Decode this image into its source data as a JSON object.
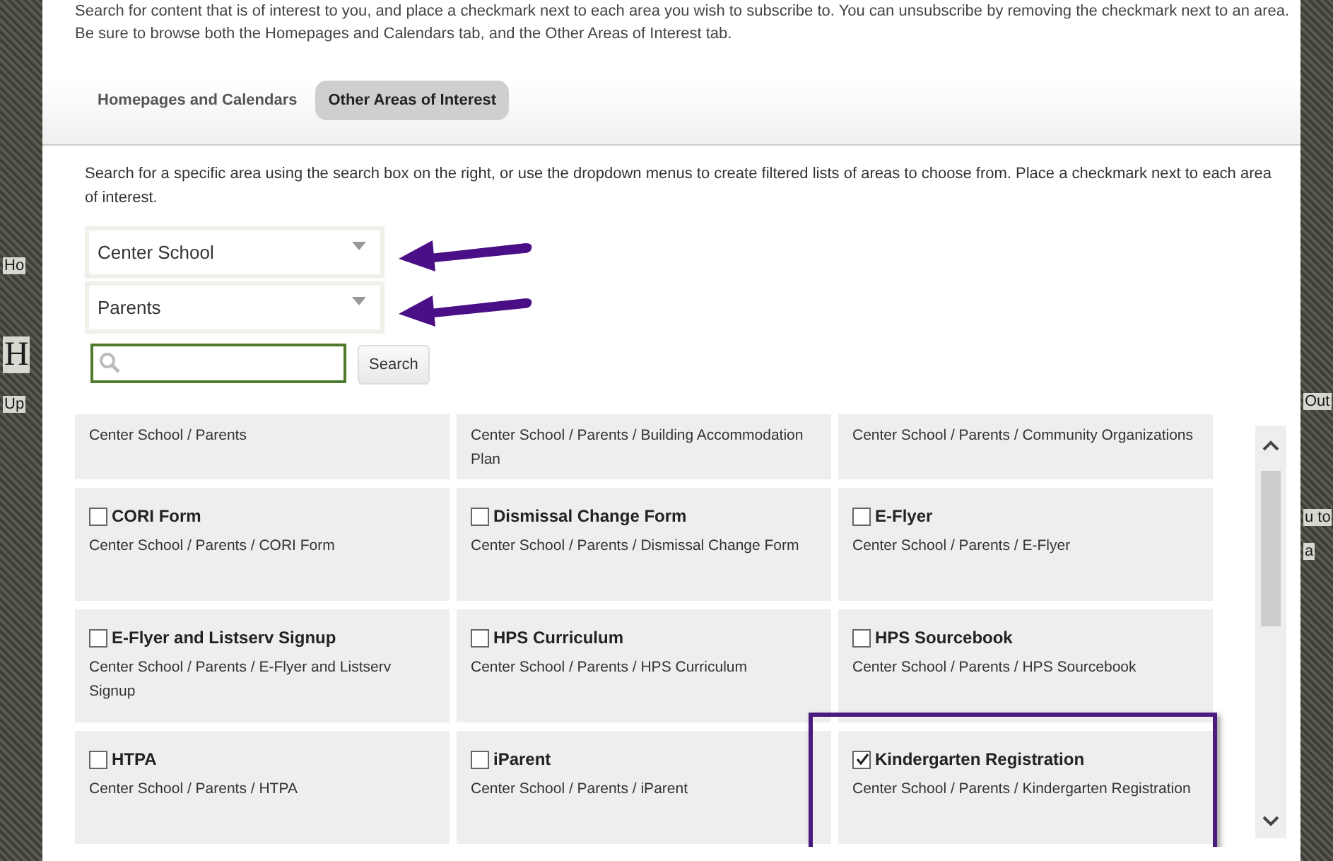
{
  "backdrop": {
    "left_texts": [
      "Ho",
      "H",
      "Up"
    ],
    "right_texts": [
      "Out",
      "u to",
      "a"
    ]
  },
  "intro": [
    "Search for content that is of interest to you, and place a checkmark next to each area you wish to subscribe to. You can unsubscribe by removing the checkmark next to an area.",
    "Be sure to browse both the Homepages and Calendars tab, and the Other Areas of Interest tab."
  ],
  "tabs": [
    {
      "label": "Homepages and Calendars",
      "selected": false
    },
    {
      "label": "Other Areas of Interest",
      "selected": true
    }
  ],
  "instructions": "Search for a specific area using the search box on the right, or use the dropdown menus to create filtered lists of areas to choose from. Place a checkmark next to each area of interest.",
  "dropdowns": [
    {
      "value": "Center School",
      "arrow": true
    },
    {
      "value": "Parents",
      "arrow": true
    }
  ],
  "search": {
    "button": "Search"
  },
  "areas": [
    {
      "path": "Center School / Parents"
    },
    {
      "path": "Center School / Parents / Building Accommodation Plan"
    },
    {
      "path": "Center School / Parents / Community Organizations"
    },
    {
      "title": "CORI Form",
      "path": "Center School / Parents / CORI Form",
      "checked": false,
      "highlighted": false
    },
    {
      "title": "Dismissal Change Form",
      "path": "Center School / Parents / Dismissal Change Form",
      "checked": false,
      "highlighted": false
    },
    {
      "title": "E-Flyer",
      "path": "Center School / Parents / E-Flyer",
      "checked": false,
      "highlighted": false
    },
    {
      "title": "E-Flyer and Listserv Signup",
      "path": "Center School / Parents / E-Flyer and Listserv Signup",
      "checked": false,
      "highlighted": false
    },
    {
      "title": "HPS Curriculum",
      "path": "Center School / Parents / HPS Curriculum",
      "checked": false,
      "highlighted": false
    },
    {
      "title": "HPS Sourcebook",
      "path": "Center School / Parents / HPS Sourcebook",
      "checked": false,
      "highlighted": false
    },
    {
      "title": "HTPA",
      "path": "Center School / Parents / HTPA",
      "checked": false,
      "highlighted": false
    },
    {
      "title": "iParent",
      "path": "Center School / Parents / iParent",
      "checked": false,
      "highlighted": false
    },
    {
      "title": "Kindergarten Registration",
      "path": "Center School / Parents / Kindergarten Registration",
      "checked": true,
      "highlighted": true
    }
  ]
}
